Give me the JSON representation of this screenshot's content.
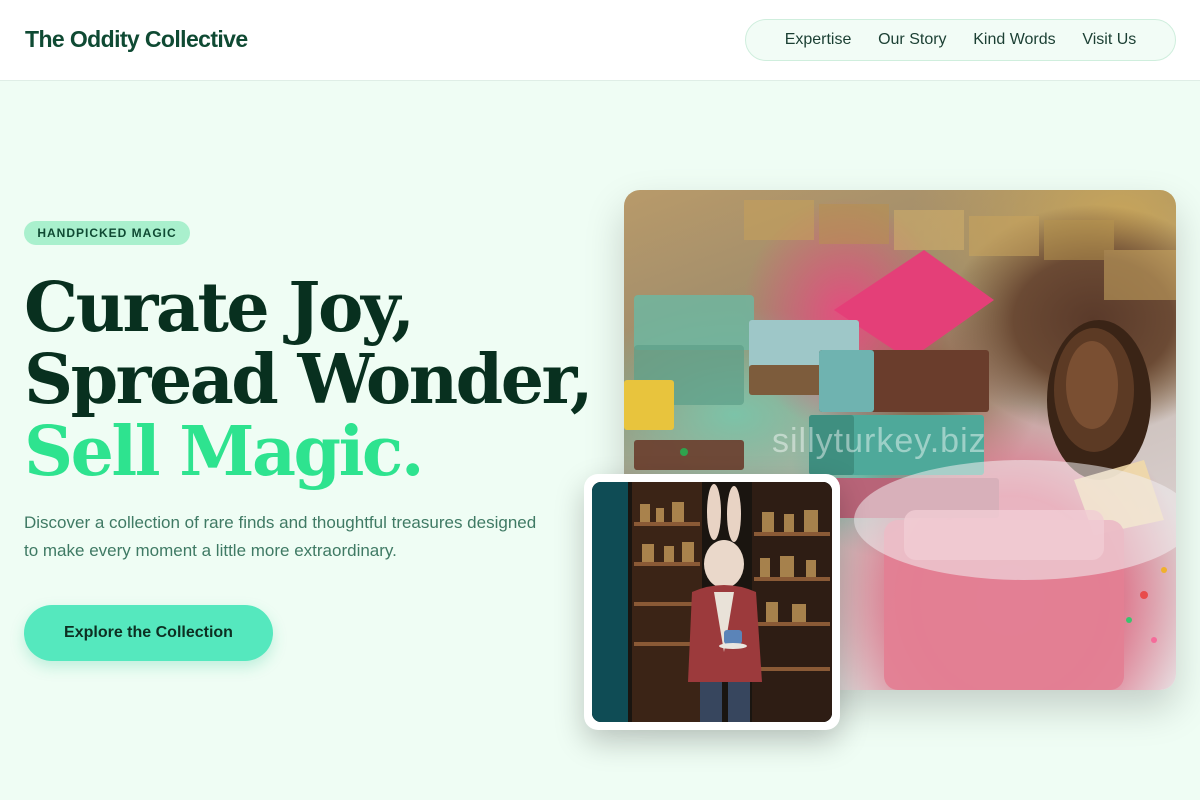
{
  "brand": {
    "name": "The Oddity Collective"
  },
  "nav": {
    "items": [
      {
        "label": "Expertise"
      },
      {
        "label": "Our Story"
      },
      {
        "label": "Kind Words"
      },
      {
        "label": "Visit Us"
      }
    ]
  },
  "hero": {
    "badge": "HANDPICKED MAGIC",
    "headline_line1": "Curate Joy,",
    "headline_line2": "Spread Wonder,",
    "headline_accent": "Sell Magic.",
    "description": "Discover a collection of rare finds and thoughtful treasures designed to make every moment a little more extraordinary.",
    "cta_label": "Explore the Collection"
  },
  "images": {
    "main_watermark": "sillyturkey.biz",
    "main_icon": "photo-handmade-soaps",
    "inset_icon": "photo-rabbit-shopkeeper"
  },
  "colors": {
    "background": "#effdf4",
    "brand": "#0f4a33",
    "accent": "#2ee38f",
    "button": "#55e8be",
    "badge": "#a9f0cd"
  }
}
